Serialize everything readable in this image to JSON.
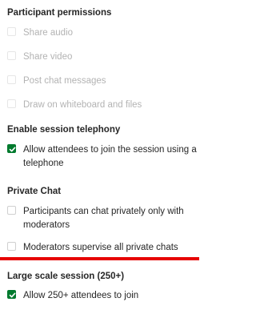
{
  "participant_permissions": {
    "heading": "Participant permissions",
    "options": [
      {
        "label": "Share audio",
        "checked": false,
        "enabled": false
      },
      {
        "label": "Share video",
        "checked": false,
        "enabled": false
      },
      {
        "label": "Post chat messages",
        "checked": false,
        "enabled": false
      },
      {
        "label": "Draw on whiteboard and files",
        "checked": false,
        "enabled": false
      }
    ]
  },
  "session_telephony": {
    "heading": "Enable session telephony",
    "option": {
      "label": "Allow attendees to join the session using a\ntelephone",
      "checked": true
    }
  },
  "private_chat": {
    "heading": "Private Chat",
    "options": [
      {
        "label": "Participants can chat privately only with\nmoderators",
        "checked": false
      },
      {
        "label": "Moderators supervise all private chats",
        "checked": false
      }
    ]
  },
  "large_scale": {
    "heading": "Large scale session (250+)",
    "option": {
      "label": "Allow 250+ attendees to join",
      "checked": true
    }
  },
  "colors": {
    "accent_check": "#007a2e",
    "divider_red": "#e60000"
  }
}
